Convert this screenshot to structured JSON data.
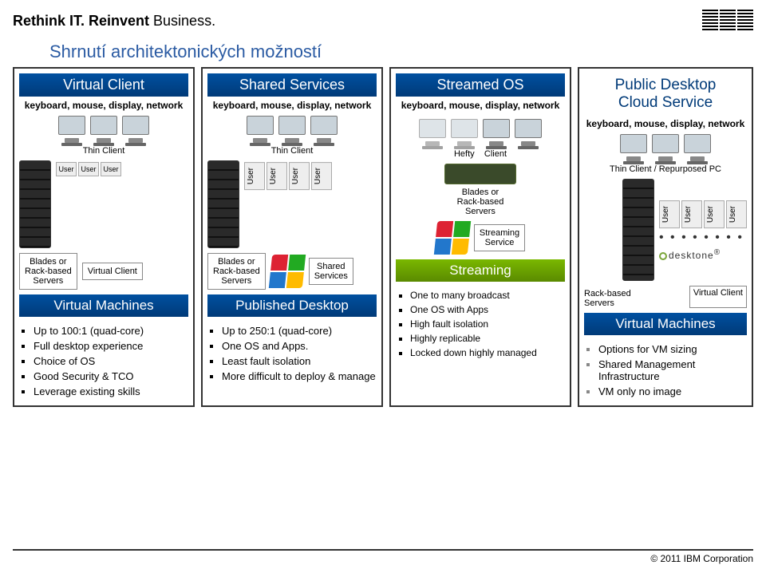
{
  "header": {
    "tagline_bold": "Rethink IT. Reinvent",
    "tagline_rest": " Business.",
    "logo_name": "ibm"
  },
  "title": "Shrnutí architektonických možností",
  "columns": [
    {
      "head": "Virtual Client",
      "subcap": "keyboard, mouse, display, network",
      "thin_label": "Thin Client",
      "rack_label": "Blades or\nRack-based\nServers",
      "mid_label": "Virtual Client",
      "bottom_head": "Virtual Machines",
      "bullets": [
        "Up to 100:1 (quad-core)",
        "Full desktop experience",
        "Choice of OS",
        "Good Security & TCO",
        "Leverage existing skills"
      ]
    },
    {
      "head": "Shared Services",
      "subcap": "keyboard, mouse, display, network",
      "thin_label": "Thin Client",
      "rack_label": "Blades or\nRack-based\nServers",
      "mid_label": "Shared\nServices",
      "bottom_head": "Published Desktop",
      "bullets": [
        "Up to 250:1 (quad-core)",
        "One OS and Apps.",
        "Least fault isolation",
        "More difficult to deploy & manage"
      ]
    },
    {
      "head": "Streamed OS",
      "subcap": "keyboard, mouse, display, network",
      "thin_label_left": "Hefty",
      "thin_label_right": "Client",
      "rack_label": "Blades or\nRack-based\nServers",
      "mid_label": "Streaming\nService",
      "bottom_head": "Streaming",
      "bullets": [
        "One to many broadcast",
        "One OS with Apps",
        "High fault isolation",
        "Highly replicable",
        "Locked down highly managed"
      ]
    },
    {
      "head": "Public Desktop\nCloud Service",
      "subcap": "keyboard, mouse, display, network",
      "thin_label": "Thin Client / Repurposed PC",
      "desktone": "desktone",
      "rack_label": "Rack-based\nServers",
      "vc_label": "Virtual Client",
      "vm_label": "Virtual Machines",
      "bullets": [
        "Options for VM sizing",
        "Shared Management Infrastructure",
        "VM only no image"
      ]
    }
  ],
  "user_chip": "User",
  "footer": "© 2011 IBM Corporation"
}
